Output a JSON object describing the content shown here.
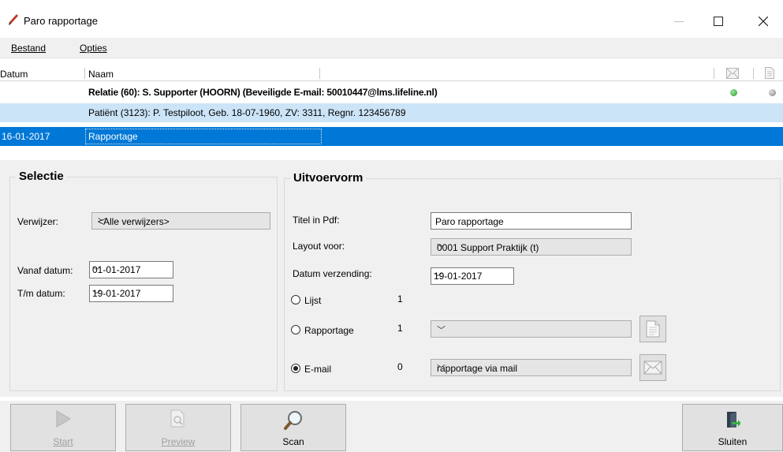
{
  "window": {
    "title": "Paro rapportage"
  },
  "menu": {
    "items": [
      {
        "label": "Bestand"
      },
      {
        "label": "Opties"
      }
    ]
  },
  "list": {
    "columns": {
      "datum": "Datum",
      "naam": "Naam"
    },
    "rows": [
      {
        "datum": "",
        "naam": "Relatie (60): S. Supporter (HOORN)  (Beveiligde E-mail: 50010447@lms.lifeline.nl)",
        "status_mail": "#35a835",
        "status_doc": "#9a9a9a"
      },
      {
        "datum": "",
        "naam": "Patiënt (3123): P. Testpiloot, Geb. 18-07-1960,  ZV: 3311,  Regnr. 123456789"
      },
      {
        "datum": "16-01-2017",
        "naam": "Rapportage"
      }
    ]
  },
  "selectie": {
    "title": "Selectie",
    "verwijzer_label": "Verwijzer:",
    "verwijzer_value": "<Alle verwijzers>",
    "vanaf_label": "Vanaf datum:",
    "vanaf_value": "01-01-2017",
    "tm_label": "T/m datum:",
    "tm_value": "19-01-2017"
  },
  "uitvoervorm": {
    "title": "Uitvoervorm",
    "titel_label": "Titel in Pdf:",
    "titel_value": "Paro rapportage",
    "layout_label": "Layout voor:",
    "layout_value": "0001 Support Praktijk (t)",
    "datum_label": "Datum verzending:",
    "datum_value": "19-01-2017",
    "options": [
      {
        "label": "Lijst",
        "count": "1",
        "selected": false
      },
      {
        "label": "Rapportage",
        "count": "1",
        "selected": false,
        "combo": ""
      },
      {
        "label": "E-mail",
        "count": "0",
        "selected": true,
        "combo": "rapportage via mail"
      }
    ]
  },
  "toolbar": {
    "start": "Start",
    "preview": "Preview",
    "scan": "Scan",
    "sluiten": "Sluiten"
  },
  "colors": {
    "selected_row": "#0078d7",
    "highlight_row": "#cce4f7",
    "status_green": "#35a835"
  }
}
